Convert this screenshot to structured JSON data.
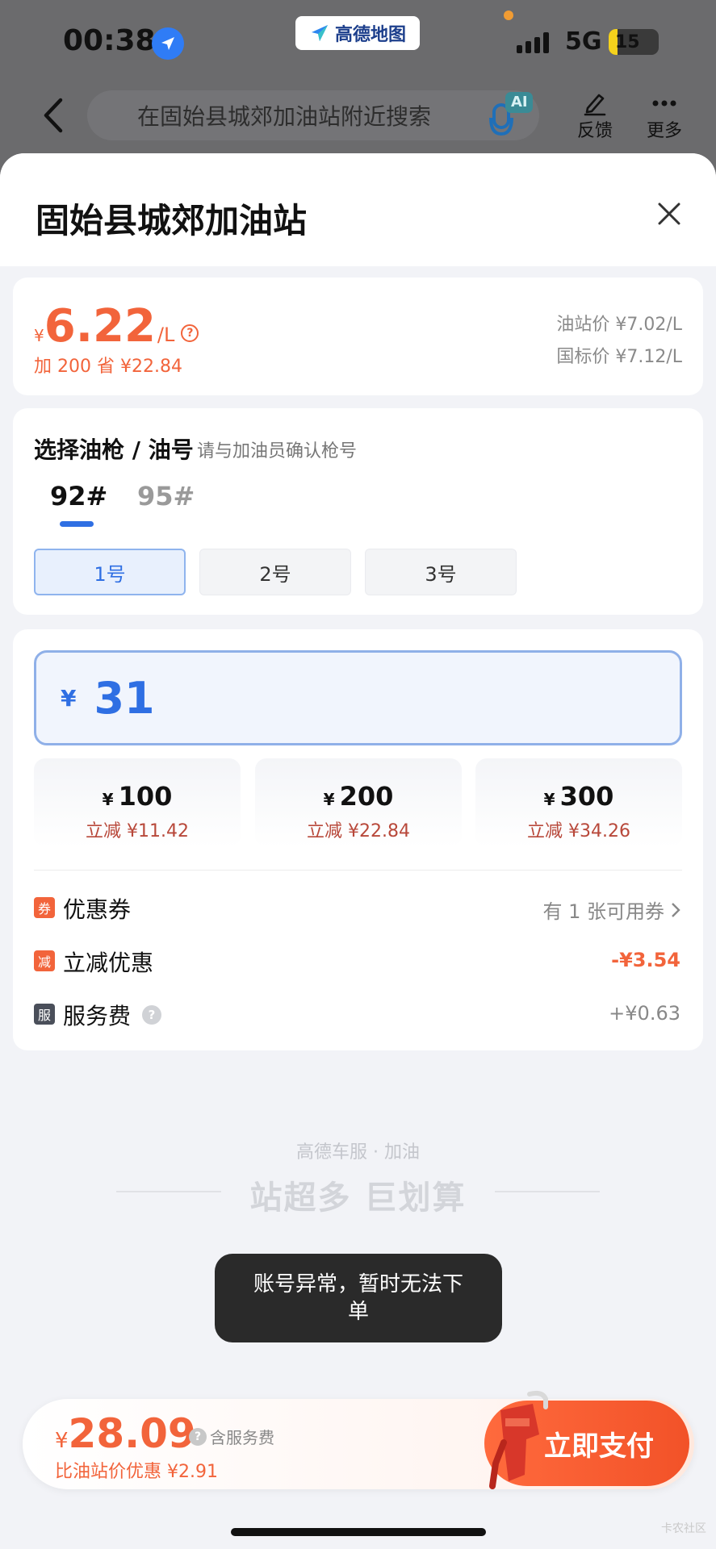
{
  "status_bar": {
    "time": "00:38",
    "app_name": "高德地图",
    "network": "5G",
    "battery": "15"
  },
  "header": {
    "search_placeholder": "在固始县城郊加油站附近搜索",
    "ai_badge": "AI",
    "feedback_label": "反馈",
    "more_label": "更多"
  },
  "station": {
    "name": "固始县城郊加油站"
  },
  "price": {
    "currency": "¥",
    "value": "6.22",
    "unit": "/L",
    "save_note": "加 200 省 ¥22.84",
    "station_price": "油站价 ¥7.02/L",
    "national_price": "国标价 ¥7.12/L"
  },
  "gun_select": {
    "title": "选择油枪 / 油号",
    "hint": "请与加油员确认枪号",
    "fuel_types": [
      "92#",
      "95#"
    ],
    "selected_fuel": "92#",
    "guns": [
      "1号",
      "2号",
      "3号"
    ],
    "selected_gun": "1号"
  },
  "amount": {
    "currency": "¥",
    "value": "31",
    "quick_options": [
      {
        "currency": "¥",
        "amount": "100",
        "discount": "立减 ¥11.42"
      },
      {
        "currency": "¥",
        "amount": "200",
        "discount": "立减 ¥22.84"
      },
      {
        "currency": "¥",
        "amount": "300",
        "discount": "立减 ¥34.26"
      }
    ]
  },
  "rows": {
    "coupon": {
      "tag": "券",
      "label": "优惠券",
      "value": "有 1 张可用券"
    },
    "discount": {
      "tag": "减",
      "label": "立减优惠",
      "value": "-¥3.54"
    },
    "service_fee": {
      "tag": "服",
      "label": "服务费",
      "value": "+¥0.63"
    }
  },
  "slogan": {
    "sub": "高德车服 · 加油",
    "main": "站超多 巨划算"
  },
  "toast": {
    "message": "账号异常，暂时无法下单"
  },
  "pay_bar": {
    "currency": "¥",
    "total": "28.09",
    "includes": "含服务费",
    "savings": "比油站价优惠 ¥2.91",
    "pay_button": "立即支付"
  },
  "watermark": "卡农社区",
  "colors": {
    "accent_orange": "#f2643b",
    "accent_blue": "#2f6fe3",
    "toast_bg": "#2a2a2a"
  }
}
